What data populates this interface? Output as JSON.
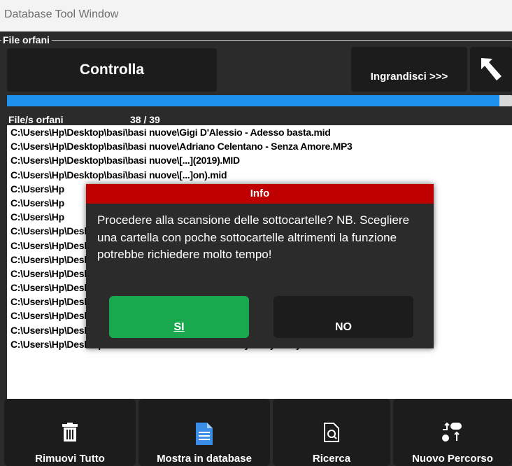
{
  "window": {
    "title": "Database Tool Window"
  },
  "group": {
    "label": "File orfani"
  },
  "toolbar": {
    "check_label": "Controlla",
    "expand_label": "Ingrandisci >>>",
    "back_icon": "arrow-back-icon"
  },
  "progress": {
    "fraction": 0.975,
    "color": "#1e90ee"
  },
  "files": {
    "label": "File/s orfani",
    "count": "38 / 39",
    "rows": [
      "C:\\Users\\Hp\\Desktop\\basi\\basi nuove\\Gigi D'Alessio - Adesso basta.mid",
      "C:\\Users\\Hp\\Desktop\\basi\\basi nuove\\Adriano Celentano - Senza Amore.MP3",
      "C:\\Users\\Hp\\Desktop\\basi\\basi nuove\\[...](2019).MID",
      "C:\\Users\\Hp\\Desktop\\basi\\basi nuove\\[...]on).mid",
      "C:\\Users\\Hp",
      "C:\\Users\\Hp",
      "C:\\Users\\Hp",
      "C:\\Users\\Hp\\Desktop\\basi\\basi nuove\\[...] Move On).l",
      "C:\\Users\\Hp\\Desktop\\basi\\basi nuove\\[...]araoke.mp3",
      "C:\\Users\\Hp\\Desktop\\basi\\basi nuove\\[...] Give me all",
      "C:\\Users\\Hp\\Desktop\\basi\\basi nuove\\[...]melblaue Au",
      "C:\\Users\\Hp\\Desktop\\basi\\basi nuove\\LAST NIGHT A DJ SAVED MY LIFE-INDEEP.mi",
      "C:\\Users\\Hp\\Desktop\\basi\\basi nuove\\Lady Gaga - Look What I Found.MID",
      "C:\\Users\\Hp\\Desktop\\basi\\basi nuove\\Ranieri - La voce del silenzio (ML).MID",
      "C:\\Users\\Hp\\Desktop\\basi\\basi nuove\\Max Pezzali - Sembro Matto.MP3",
      "C:\\Users\\Hp\\Desktop\\basi\\basi nuove\\AA.VV. - Medley Hully Gully - Vol.3.mid"
    ]
  },
  "bottom": {
    "remove_all": "Rimuovi Tutto",
    "show_db": "Mostra in database",
    "search": "Ricerca",
    "new_path": "Nuovo Percorso"
  },
  "dialog": {
    "title": "Info",
    "message": "Procedere alla scansione delle sottocartelle? NB. Scegliere una cartella con poche sottocartelle altrimenti la funzione potrebbe richiedere molto tempo!",
    "yes_label": "SI",
    "no_label": "NO"
  }
}
